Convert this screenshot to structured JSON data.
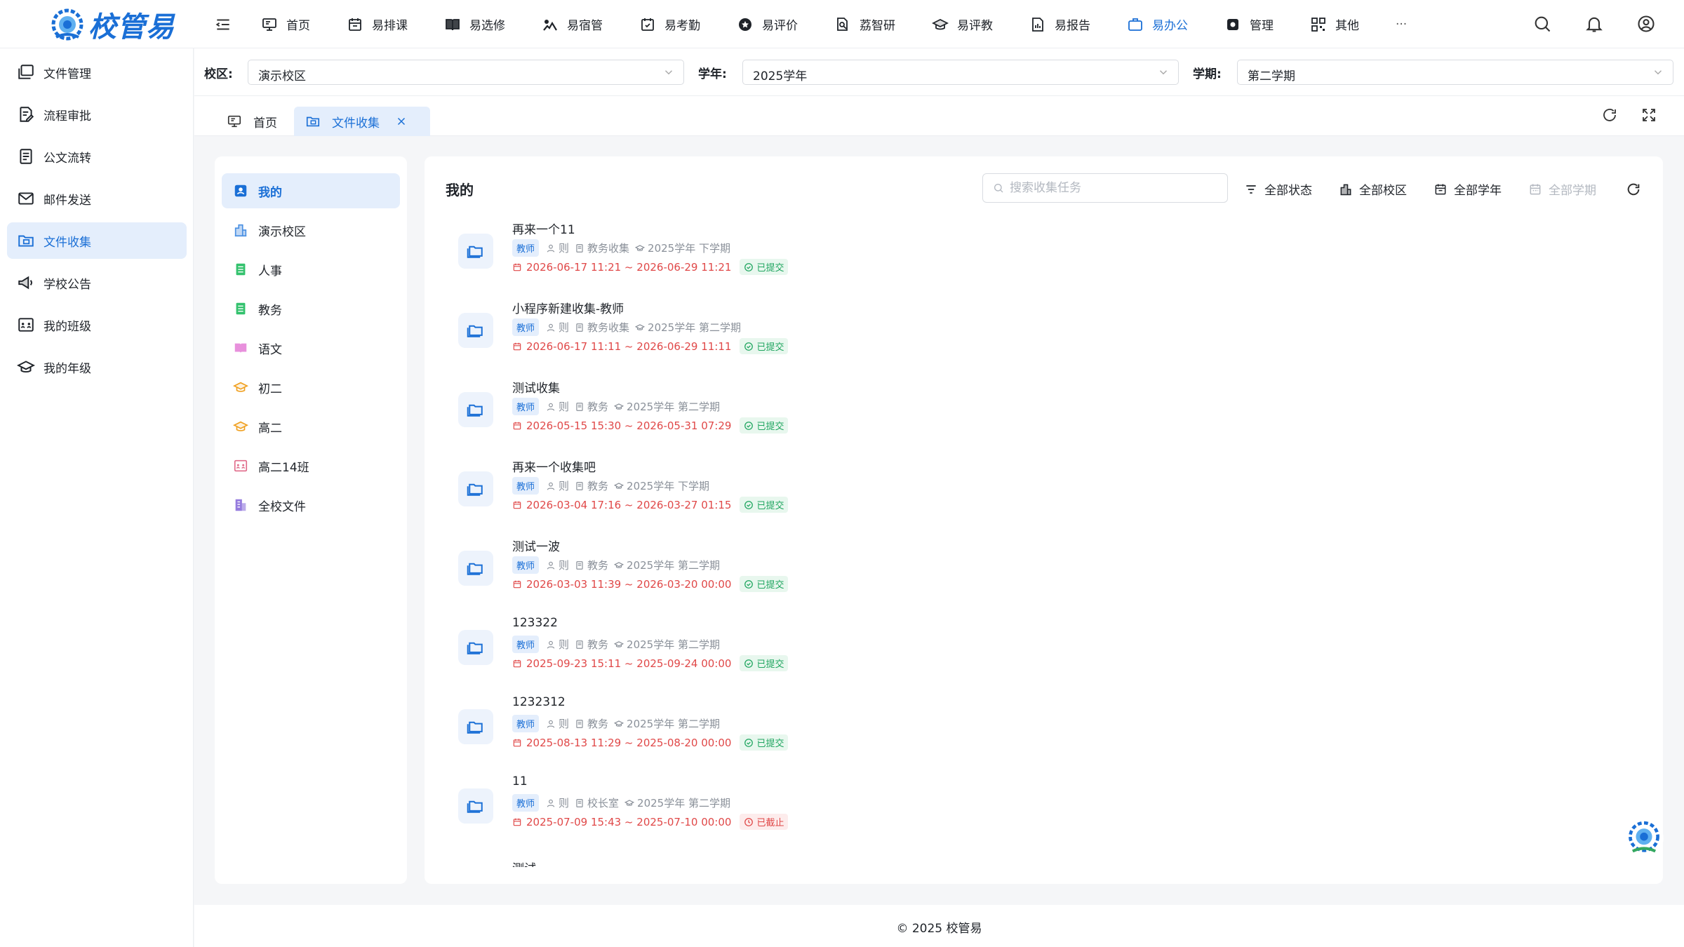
{
  "brand": {
    "name": "校管易",
    "logo_icon": "gear-gem-logo",
    "accent": "#1a6fd6"
  },
  "topnav": {
    "items": [
      {
        "label": "首页",
        "icon": "monitor-icon",
        "active": false
      },
      {
        "label": "易排课",
        "icon": "calendar-icon",
        "active": false
      },
      {
        "label": "易选修",
        "icon": "book-icon",
        "active": false
      },
      {
        "label": "易宿管",
        "icon": "bed-icon",
        "active": false
      },
      {
        "label": "易考勤",
        "icon": "check-calendar-icon",
        "active": false
      },
      {
        "label": "易评价",
        "icon": "star-icon",
        "active": false
      },
      {
        "label": "荔智研",
        "icon": "research-icon",
        "active": false
      },
      {
        "label": "易评教",
        "icon": "graduation-cap-icon",
        "active": false
      },
      {
        "label": "易报告",
        "icon": "report-icon",
        "active": false
      },
      {
        "label": "易办公",
        "icon": "briefcase-icon",
        "active": true
      },
      {
        "label": "管理",
        "icon": "settings-icon",
        "active": false
      },
      {
        "label": "其他",
        "icon": "grid-icon",
        "active": false
      }
    ],
    "more": "···"
  },
  "sidebar": {
    "items": [
      {
        "label": "文件管理",
        "icon": "folders-icon",
        "active": false
      },
      {
        "label": "流程审批",
        "icon": "edit-doc-icon",
        "active": false
      },
      {
        "label": "公文流转",
        "icon": "documents-icon",
        "active": false
      },
      {
        "label": "邮件发送",
        "icon": "mail-icon",
        "active": false
      },
      {
        "label": "文件收集",
        "icon": "folder-collect-icon",
        "active": true
      },
      {
        "label": "学校公告",
        "icon": "megaphone-icon",
        "active": false
      },
      {
        "label": "我的班级",
        "icon": "class-icon",
        "active": false
      },
      {
        "label": "我的年级",
        "icon": "grade-icon",
        "active": false
      }
    ]
  },
  "filters": {
    "campus": {
      "label": "校区:",
      "value": "演示校区"
    },
    "year": {
      "label": "学年:",
      "value": "2025学年"
    },
    "term": {
      "label": "学期:",
      "value": "第二学期"
    }
  },
  "tabs": [
    {
      "label": "首页",
      "icon": "monitor-icon",
      "active": false
    },
    {
      "label": "文件收集",
      "icon": "folder-collect-icon",
      "active": true
    }
  ],
  "categories": [
    {
      "label": "我的",
      "icon": "user-card-icon",
      "color": "#1a6fd6",
      "active": true
    },
    {
      "label": "演示校区",
      "icon": "building-icon",
      "color": "#4a90e2",
      "active": false
    },
    {
      "label": "人事",
      "icon": "sheet-icon",
      "color": "#34c26e",
      "active": false
    },
    {
      "label": "教务",
      "icon": "sheet-icon",
      "color": "#34c26e",
      "active": false
    },
    {
      "label": "语文",
      "icon": "open-book-icon",
      "color": "#e06bd0",
      "active": false
    },
    {
      "label": "初二",
      "icon": "graduation-cap-icon",
      "color": "#f0a020",
      "active": false
    },
    {
      "label": "高二",
      "icon": "graduation-cap-icon",
      "color": "#f0a020",
      "active": false
    },
    {
      "label": "高二14班",
      "icon": "class-icon",
      "color": "#e06b8a",
      "active": false
    },
    {
      "label": "全校文件",
      "icon": "buildings-icon",
      "color": "#7a5ad6",
      "active": false
    }
  ],
  "main": {
    "title": "我的",
    "search_placeholder": "搜索收集任务",
    "filter_items": [
      {
        "label": "全部状态",
        "icon": "filter-icon",
        "disabled": false
      },
      {
        "label": "全部校区",
        "icon": "building-icon",
        "disabled": false
      },
      {
        "label": "全部学年",
        "icon": "calendar-icon",
        "disabled": false
      },
      {
        "label": "全部学期",
        "icon": "calendar-grid-icon",
        "disabled": true
      }
    ],
    "tasks": [
      {
        "title": "再来一个11",
        "badge": "教师",
        "owner": "则",
        "category": "教务收集",
        "term": "2025学年 下学期",
        "dates": "2026-06-17 11:21 ~ 2026-06-29 11:21",
        "status": "已提交",
        "status_type": "ok"
      },
      {
        "title": "小程序新建收集-教师",
        "badge": "教师",
        "owner": "则",
        "category": "教务收集",
        "term": "2025学年 第二学期",
        "dates": "2026-06-17 11:11 ~ 2026-06-29 11:11",
        "status": "已提交",
        "status_type": "ok"
      },
      {
        "title": "测试收集",
        "badge": "教师",
        "owner": "则",
        "category": "教务",
        "term": "2025学年 第二学期",
        "dates": "2026-05-15 15:30 ~ 2026-05-31 07:29",
        "status": "已提交",
        "status_type": "ok"
      },
      {
        "title": "再来一个收集吧",
        "badge": "教师",
        "owner": "则",
        "category": "教务",
        "term": "2025学年 下学期",
        "dates": "2026-03-04 17:16 ~ 2026-03-27 01:15",
        "status": "已提交",
        "status_type": "ok"
      },
      {
        "title": "测试一波",
        "badge": "教师",
        "owner": "则",
        "category": "教务",
        "term": "2025学年 第二学期",
        "dates": "2026-03-03 11:39 ~ 2026-03-20 00:00",
        "status": "已提交",
        "status_type": "ok"
      },
      {
        "title": "123322",
        "badge": "教师",
        "owner": "则",
        "category": "教务",
        "term": "2025学年 第二学期",
        "dates": "2025-09-23 15:11 ~ 2025-09-24 00:00",
        "status": "已提交",
        "status_type": "ok"
      },
      {
        "title": "1232312",
        "badge": "教师",
        "owner": "则",
        "category": "教务",
        "term": "2025学年 第二学期",
        "dates": "2025-08-13 11:29 ~ 2025-08-20 00:00",
        "status": "已提交",
        "status_type": "ok"
      },
      {
        "title": "11",
        "badge": "教师",
        "owner": "则",
        "category": "校长室",
        "term": "2025学年 第二学期",
        "dates": "2025-07-09 15:43 ~ 2025-07-10 00:00",
        "status": "已截止",
        "status_type": "closed"
      }
    ],
    "partial_title": "测试"
  },
  "footer": "© 2025 校管易"
}
